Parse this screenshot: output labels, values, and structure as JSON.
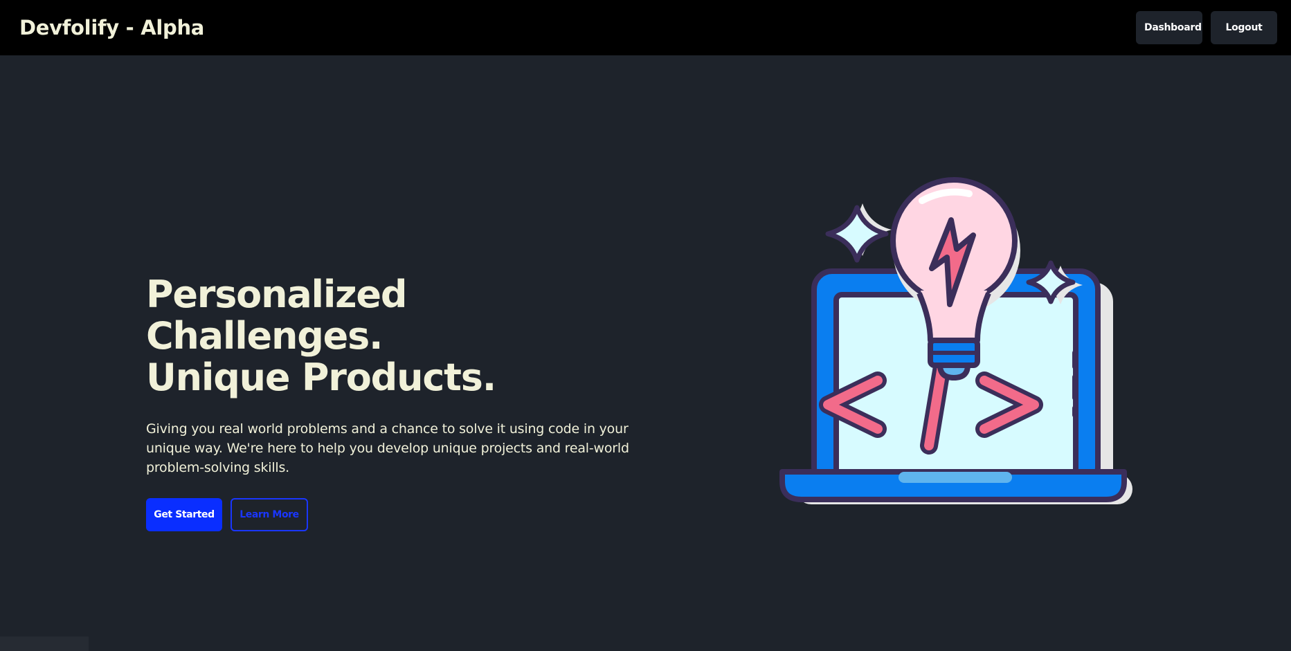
{
  "navbar": {
    "brand": "Devfolify - Alpha",
    "dashboard_label": "Dashboard",
    "logout_label": "Logout"
  },
  "hero": {
    "title_line1": "Personalized Challenges.",
    "title_line2": "Unique Products.",
    "description": "Giving you real world problems and a chance to solve it using code in your unique way. We're here to help you develop unique projects and real-world problem-solving skills.",
    "primary_cta": "Get Started",
    "secondary_cta": "Learn More",
    "illustration_icon": "laptop-code-lightbulb-icon"
  },
  "colors": {
    "page_bg": "#1e232b",
    "navbar_bg": "#000000",
    "text_cream": "#f1f1d9",
    "accent_blue": "#0a2eff"
  }
}
